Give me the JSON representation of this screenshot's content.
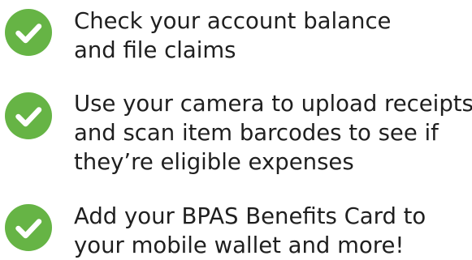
{
  "features": [
    {
      "icon": "check-circle-icon",
      "lines": [
        "Check your account balance",
        "and file claims"
      ]
    },
    {
      "icon": "check-circle-icon",
      "lines": [
        "Use your camera to upload receipts",
        "and scan item barcodes to see if",
        "they’re eligible expenses"
      ]
    },
    {
      "icon": "check-circle-icon",
      "lines": [
        "Add your BPAS Benefits Card to",
        "your mobile wallet and more!"
      ]
    }
  ],
  "colors": {
    "check_green": "#66b445",
    "check_mark": "#ffffff",
    "text": "#1f1f1f"
  }
}
